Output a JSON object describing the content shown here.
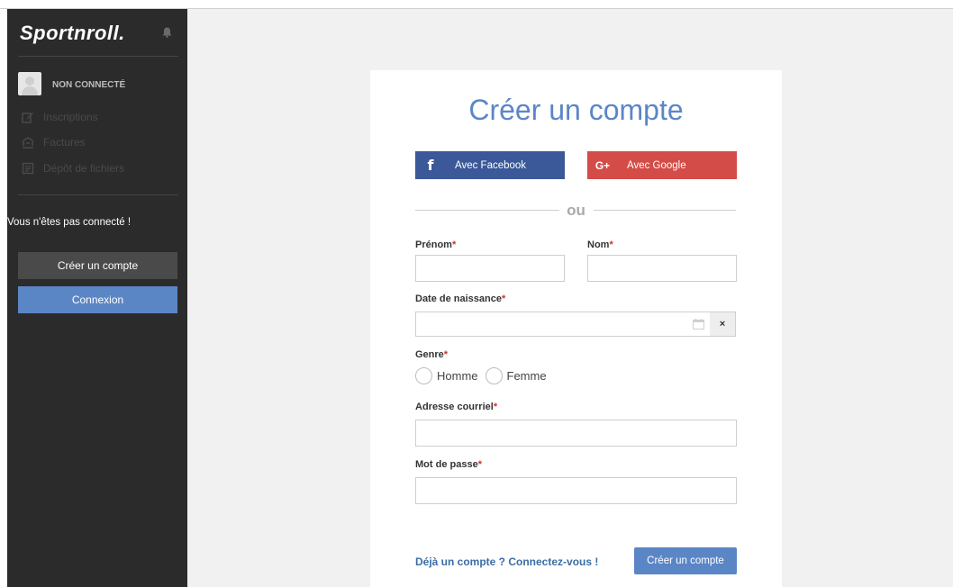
{
  "sidebar": {
    "logo": "Sportnroll.",
    "user_status": "NON CONNECTÉ",
    "nav": [
      {
        "label": "Inscriptions",
        "icon": "edit-icon"
      },
      {
        "label": "Factures",
        "icon": "invoice-icon"
      },
      {
        "label": "Dépôt de fichiers",
        "icon": "file-icon"
      }
    ],
    "not_connected_msg": "Vous n'êtes pas connecté !",
    "create_account_label": "Créer un compte",
    "login_label": "Connexion"
  },
  "form": {
    "title": "Créer un compte",
    "facebook_label": "Avec Facebook",
    "google_label": "Avec Google",
    "google_icon_text": "G+",
    "or_text": "ou",
    "required_mark": "*",
    "first_name_label": "Prénom",
    "last_name_label": "Nom",
    "birthdate_label": "Date de naissance",
    "clear_glyph": "×",
    "gender_label": "Genre",
    "gender_options": [
      "Homme",
      "Femme"
    ],
    "email_label": "Adresse courriel",
    "password_label": "Mot de passe",
    "login_link": "Déjà un compte ? Connectez-vous !",
    "submit_label": "Créer un compte"
  },
  "colors": {
    "accent": "#5b86c6",
    "facebook": "#3b5998",
    "google": "#d34c47",
    "sidebar_bg": "#2b2b2b",
    "required": "#c0392b"
  }
}
